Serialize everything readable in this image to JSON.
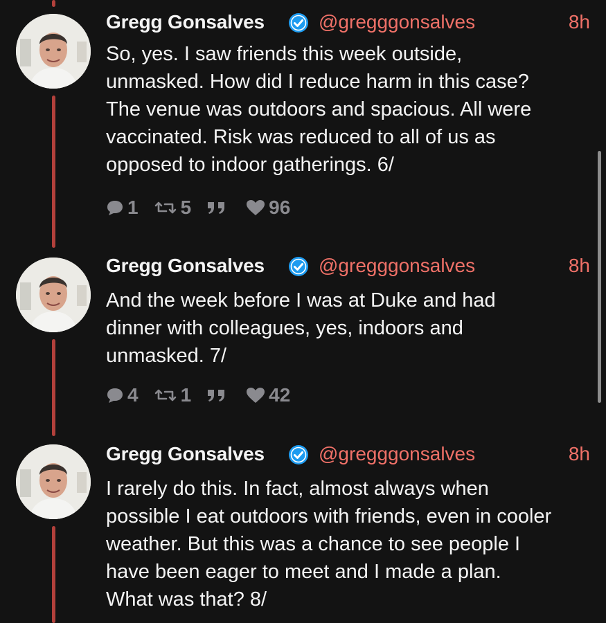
{
  "tweets": [
    {
      "display_name": "Gregg Gonsalves",
      "handle": "@gregggonsalves",
      "time": "8h",
      "verified": true,
      "text_lines": [
        "So, yes. I saw friends this week outside,",
        "unmasked. How did I reduce harm in this case?",
        "The venue was outdoors and spacious. All were",
        "vaccinated. Risk was reduced to all of us as",
        "opposed to indoor gatherings. 6/"
      ],
      "replies": "1",
      "retweets": "5",
      "likes": "96"
    },
    {
      "display_name": "Gregg Gonsalves",
      "handle": "@gregggonsalves",
      "time": "8h",
      "verified": true,
      "text_lines": [
        "And the week before I was at Duke and had",
        "dinner with colleagues, yes, indoors and",
        "unmasked. 7/"
      ],
      "replies": "4",
      "retweets": "1",
      "likes": "42"
    },
    {
      "display_name": "Gregg Gonsalves",
      "handle": "@gregggonsalves",
      "time": "8h",
      "verified": true,
      "text_lines": [
        "I rarely do this. In fact, almost always when",
        "possible I eat outdoors with friends, even in cooler",
        "weather. But this was a chance to see people I",
        "have been eager to meet and I made a plan.",
        "What was that? 8/"
      ]
    }
  ],
  "icons": {
    "reply": "reply-icon",
    "retweet": "retweet-icon",
    "quote": "quote-icon",
    "like": "heart-icon",
    "verified": "verified-badge-icon"
  },
  "colors": {
    "background": "#131313",
    "thread_line": "#b2403b",
    "accent": "#f07168",
    "verified": "#1d9bf0",
    "action_gray": "#8a8a8f"
  }
}
